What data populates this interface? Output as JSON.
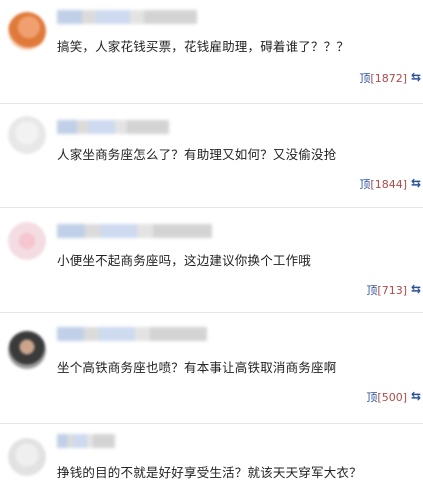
{
  "comments": [
    {
      "content": "搞笑，人家花钱买票，花钱雇助理，碍着谁了？？？",
      "vote_label": "顶",
      "vote_count": "[1872]"
    },
    {
      "content": "人家坐商务座怎么了？有助理又如何？又没偷没抢",
      "vote_label": "顶",
      "vote_count": "[1844]"
    },
    {
      "content": "小便坐不起商务座吗，这边建议你换个工作哦",
      "vote_label": "顶",
      "vote_count": "[713]"
    },
    {
      "content": "坐个高铁商务座也喷？有本事让高铁取消商务座啊",
      "vote_label": "顶",
      "vote_count": "[500]"
    },
    {
      "content": "挣钱的目的不就是好好享受生活？就该天天穿军大衣？",
      "vote_label": "",
      "vote_count": ""
    }
  ],
  "icons": {
    "avatar": "avatar-icon",
    "share": "share-icon"
  }
}
